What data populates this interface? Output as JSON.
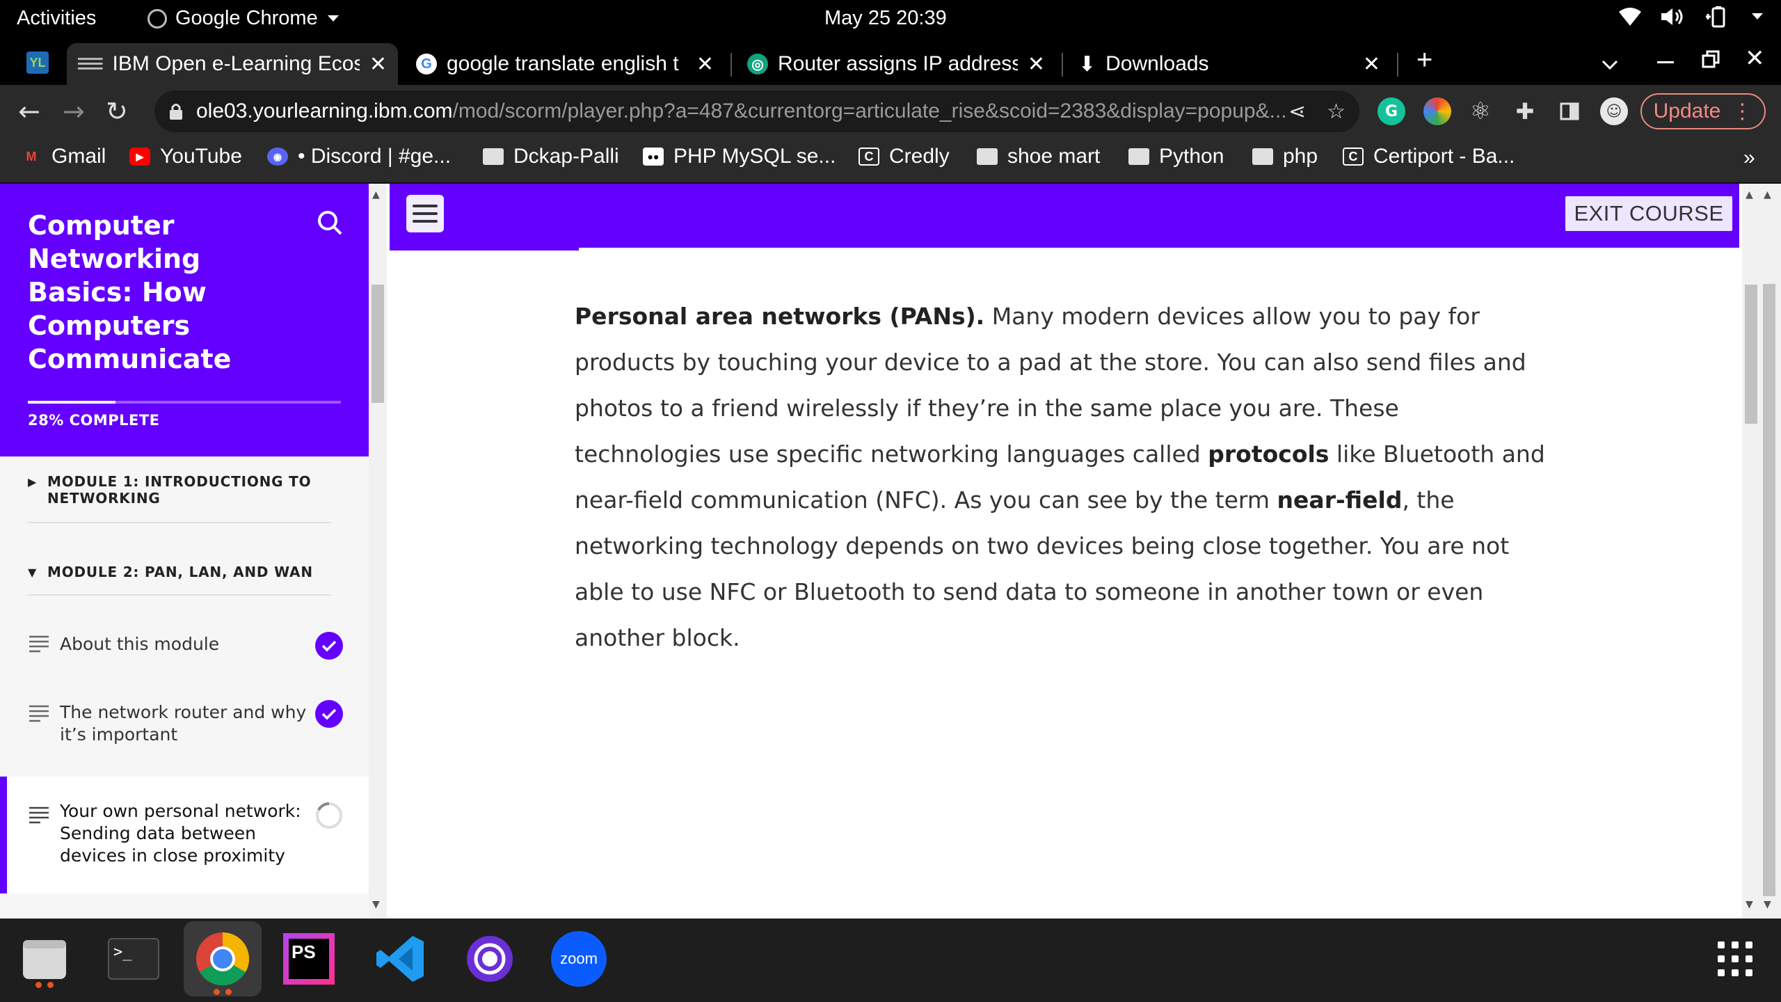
{
  "topbar": {
    "activities": "Activities",
    "app_name": "Google Chrome",
    "clock": "May 25  20:39"
  },
  "tabs": [
    {
      "title": "IBM Open e-Learning Ecos",
      "active": true
    },
    {
      "title": "google translate english t",
      "active": false
    },
    {
      "title": "Router assigns IP address",
      "active": false
    },
    {
      "title": "Downloads",
      "active": false
    }
  ],
  "toolbar": {
    "url_host": "ole03.yourlearning.ibm.com",
    "url_path": "/mod/scorm/player.php?a=487&currentorg=articulate_rise&scoid=2383&display=popup&...",
    "update_label": "Update"
  },
  "bookmarks": [
    {
      "label": "Gmail",
      "icon": "gmail-icon"
    },
    {
      "label": "YouTube",
      "icon": "youtube-icon"
    },
    {
      "label": "• Discord | #ge...",
      "icon": "discord-icon"
    },
    {
      "label": "Dckap-Palli",
      "icon": "folder-icon"
    },
    {
      "label": "PHP MySQL se...",
      "icon": "medium-icon"
    },
    {
      "label": "Credly",
      "icon": "credly-icon"
    },
    {
      "label": "shoe mart",
      "icon": "folder-icon"
    },
    {
      "label": "Python",
      "icon": "folder-icon"
    },
    {
      "label": "php",
      "icon": "folder-icon"
    },
    {
      "label": "Certiport - Ba...",
      "icon": "certiport-icon"
    }
  ],
  "sidebar": {
    "course_title": "Computer Networking Basics: How Computers Communicate",
    "progress_label": "28% COMPLETE",
    "progress_fraction": 0.28,
    "modules": [
      {
        "label": "MODULE 1: INTRODUCTIONG TO NETWORKING",
        "expanded": false
      },
      {
        "label": "MODULE 2: PAN, LAN, AND WAN",
        "expanded": true
      }
    ],
    "lessons": [
      {
        "title": "About this module",
        "status": "complete"
      },
      {
        "title": "The network router and why it’s important",
        "status": "complete"
      },
      {
        "title": "Your own personal network: Sending data between devices in close proximity",
        "status": "in-progress"
      }
    ]
  },
  "content": {
    "exit_label": "EXIT COURSE",
    "paragraph": {
      "lead_bold": "Personal area networks (PANs).",
      "part1": " Many modern devices allow you to pay for products by touching your device to a pad at the store. You can also send files and photos to a friend wirelessly if they’re in the same place you are. These technologies use specific networking languages called ",
      "bold2": "protocols",
      "part2": " like Bluetooth and near-field communication (NFC). As you can see by the term ",
      "bold3": "near-field",
      "part3": ", the networking technology depends on two devices being close together. You are not able to use NFC or Bluetooth to send data to someone in another town or even another block."
    }
  },
  "dock": {
    "zoom_label": "zoom",
    "phpstorm_label": "PS",
    "terminal_label": ">_"
  },
  "colors": {
    "accent": "#6400ff",
    "update": "#f28b82"
  }
}
